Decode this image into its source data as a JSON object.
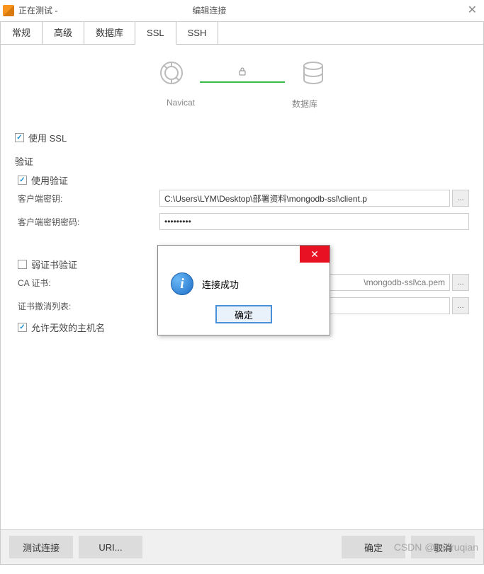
{
  "titlebar": {
    "left": "正在测试 -",
    "right": "编辑连接"
  },
  "tabs": {
    "general": "常规",
    "advanced": "高级",
    "database": "数据库",
    "ssl": "SSL",
    "ssh": "SSH"
  },
  "diagram": {
    "navicat_label": "Navicat",
    "db_label": "数据库"
  },
  "form": {
    "use_ssl": "使用 SSL",
    "auth_section": "验证",
    "use_auth": "使用验证",
    "client_key_label": "客户端密钥:",
    "client_key_value": "C:\\Users\\LYM\\Desktop\\部署资料\\mongodb-ssl\\client.p",
    "client_pass_label": "客户端密钥密码:",
    "client_pass_value": "•••••••••",
    "weak_cert": "弱证书验证",
    "ca_cert_label": "CA 证书:",
    "ca_cert_value": "\\mongodb-ssl\\ca.pem",
    "crl_label": "证书撤消列表:",
    "crl_value": "",
    "allow_invalid": "允许无效的主机名"
  },
  "modal": {
    "message": "连接成功",
    "ok": "确定"
  },
  "bottom": {
    "test": "测试连接",
    "uri": "URI...",
    "ok": "确定",
    "cancel": "取消"
  },
  "watermark": "CSDN @yanruqian"
}
